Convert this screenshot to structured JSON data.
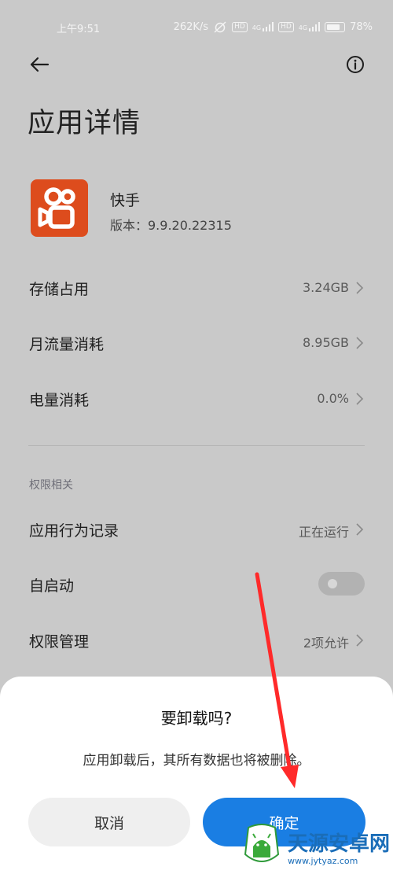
{
  "status_bar": {
    "time": "上午9:51",
    "network_speed": "262K/s",
    "sim1_badge": "HD",
    "sim1_signal": "4G",
    "sim2_badge": "HD",
    "sim2_signal": "4G",
    "battery_percent": "78%",
    "battery_level": 0.78
  },
  "header": {
    "back_icon": "arrow-left-icon",
    "info_icon": "info-circle-icon",
    "title": "应用详情"
  },
  "app": {
    "name": "快手",
    "version": "版本：9.9.20.22315",
    "brand_color": "#dd4c1d"
  },
  "rows": [
    {
      "label": "存储占用",
      "value": "3.24GB"
    },
    {
      "label": "月流量消耗",
      "value": "8.95GB"
    },
    {
      "label": "电量消耗",
      "value": "0.0%"
    }
  ],
  "permissions": {
    "section_title": "权限相关",
    "activity_label": "应用行为记录",
    "activity_value": "正在运行",
    "autostart_label": "自启动",
    "autostart_enabled": false,
    "manage_label": "权限管理",
    "manage_value": "2项允许"
  },
  "dialog": {
    "title": "要卸载吗?",
    "message": "应用卸载后，其所有数据也将被删除。",
    "cancel_label": "取消",
    "confirm_label": "确定",
    "accent_color": "#1a7ee3"
  },
  "annotation": {
    "arrow_color": "#ff2a2a"
  },
  "watermark": {
    "brand": "天源安卓网",
    "url": "www.jytyaz.com"
  }
}
